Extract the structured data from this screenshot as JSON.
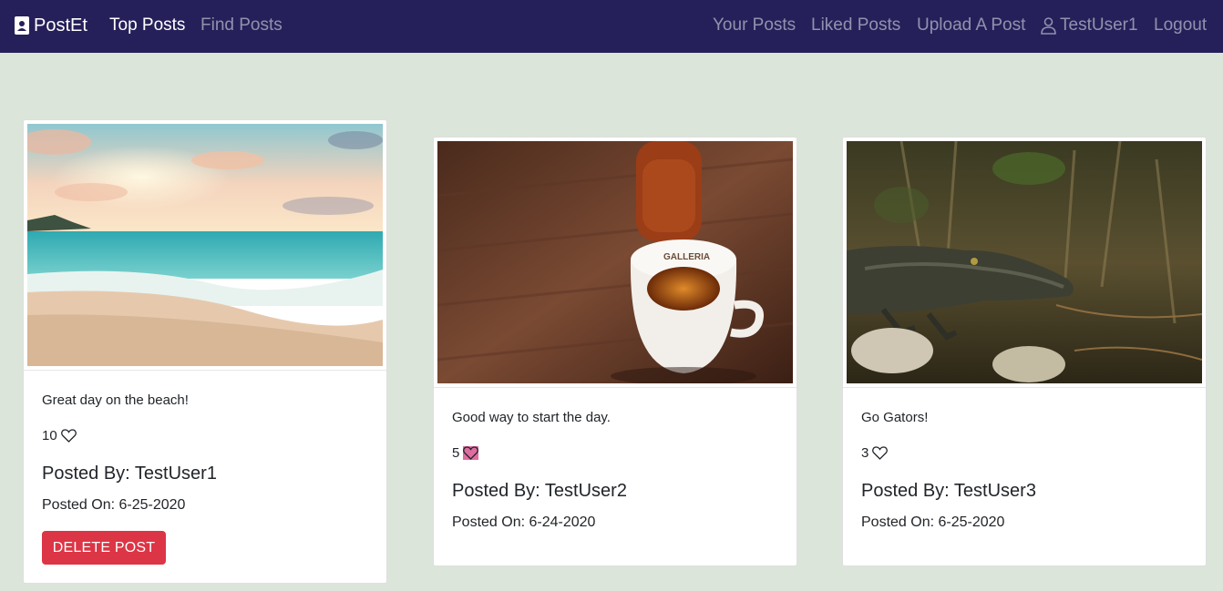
{
  "navbar": {
    "brand": "PostEt",
    "links_left": [
      {
        "label": "Top Posts",
        "active": true
      },
      {
        "label": "Find Posts",
        "active": false
      }
    ],
    "links_right": {
      "your_posts": "Your Posts",
      "liked_posts": "Liked Posts",
      "upload": "Upload A Post",
      "user": "TestUser1",
      "logout": "Logout"
    }
  },
  "posts": [
    {
      "image": "beach-sunset",
      "caption": "Great day on the beach!",
      "likes": "10",
      "liked": false,
      "author": "Posted By: TestUser1",
      "date": "Posted On: 6-25-2020",
      "delete_label": "DELETE POST"
    },
    {
      "image": "espresso-cup",
      "caption": "Good way to start the day.",
      "likes": "5",
      "liked": true,
      "author": "Posted By: TestUser2",
      "date": "Posted On: 6-24-2020"
    },
    {
      "image": "alligator",
      "caption": "Go Gators!",
      "likes": "3",
      "liked": false,
      "author": "Posted By: TestUser3",
      "date": "Posted On: 6-25-2020"
    }
  ],
  "colors": {
    "navbar": "#252059",
    "background": "#dbe5da",
    "danger": "#dc3545",
    "liked_heart": "#e06c9f"
  }
}
